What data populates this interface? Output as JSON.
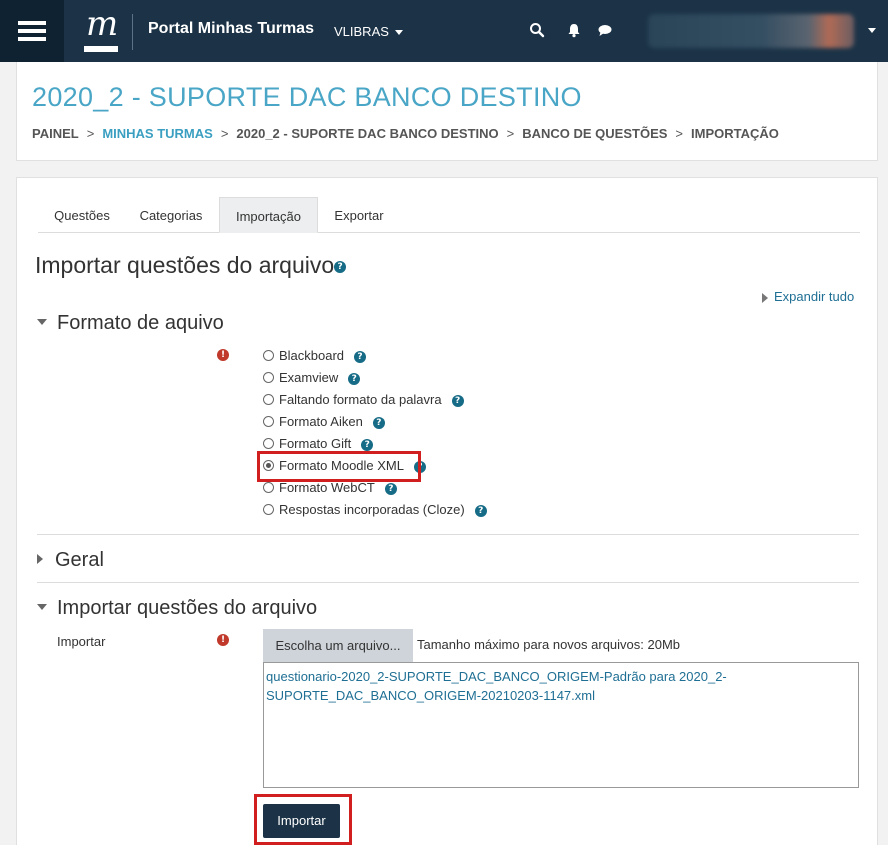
{
  "navbar": {
    "site_name": "Portal Minhas Turmas",
    "logo_letter": "m",
    "language": "VLIBRAS",
    "icons": [
      "menu-icon",
      "search-icon",
      "bell-icon",
      "chat-icon",
      "chevron-down-icon"
    ]
  },
  "header": {
    "title": "2020_2 - SUPORTE DAC BANCO DESTINO",
    "breadcrumb": [
      "PAINEL",
      "MINHAS TURMAS",
      "2020_2 - SUPORTE DAC BANCO DESTINO",
      "BANCO DE QUESTÕES",
      "IMPORTAÇÃO"
    ],
    "breadcrumb_sep": ">"
  },
  "tabs": [
    {
      "label": "Questões",
      "active": false
    },
    {
      "label": "Categorias",
      "active": false
    },
    {
      "label": "Importação",
      "active": true
    },
    {
      "label": "Exportar",
      "active": false
    }
  ],
  "main": {
    "heading": "Importar questões do arquivo",
    "expand_all": "Expandir tudo"
  },
  "format_section": {
    "legend": "Formato de aquivo",
    "options": [
      {
        "label": "Blackboard",
        "checked": false
      },
      {
        "label": "Examview",
        "checked": false
      },
      {
        "label": "Faltando formato da palavra",
        "checked": false
      },
      {
        "label": "Formato Aiken",
        "checked": false
      },
      {
        "label": "Formato Gift",
        "checked": false
      },
      {
        "label": "Formato Moodle XML",
        "checked": true
      },
      {
        "label": "Formato WebCT",
        "checked": false
      },
      {
        "label": "Respostas incorporadas (Cloze)",
        "checked": false
      }
    ]
  },
  "general_section": {
    "legend": "Geral"
  },
  "import_section": {
    "legend": "Importar questões do arquivo",
    "field_label": "Importar",
    "choose_button": "Escolha um arquivo...",
    "max_size": "Tamanho máximo para novos arquivos: 20Mb",
    "file_name": "questionario-2020_2-SUPORTE_DAC_BANCO_ORIGEM-Padrão para 2020_2-SUPORTE_DAC_BANCO_ORIGEM-20210203-1147.xml",
    "submit_label": "Importar"
  },
  "colors": {
    "navbar": "#1c3347",
    "accent": "#4aa6c6",
    "link": "#1f6f94",
    "highlight": "#d11f1f"
  }
}
